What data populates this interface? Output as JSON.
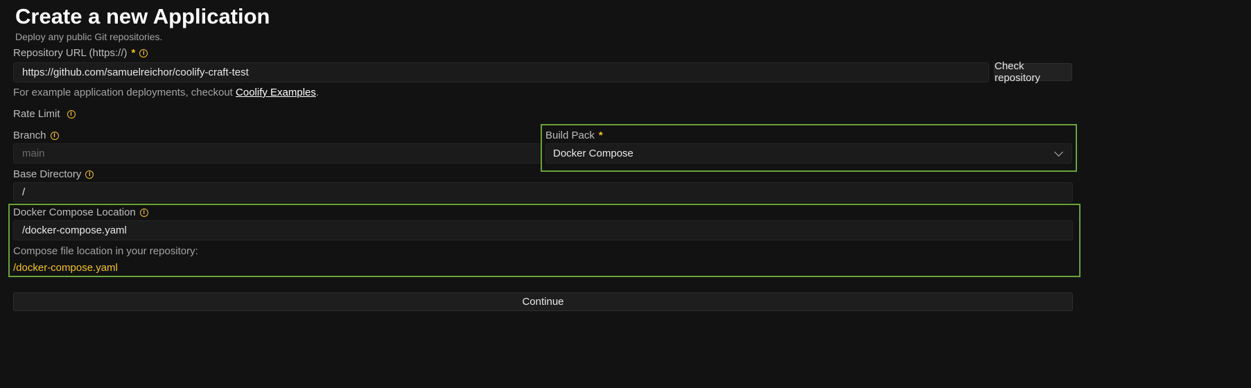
{
  "header": {
    "title": "Create a new Application",
    "subtitle": "Deploy any public Git repositories."
  },
  "repository": {
    "label": "Repository URL (https://)",
    "required_mark": "*",
    "value": "https://github.com/samuelreichor/coolify-craft-test",
    "check_button": "Check repository",
    "example_prefix": "For example application deployments, checkout ",
    "example_link": "Coolify Examples",
    "example_suffix": "."
  },
  "rate_limit": {
    "label": "Rate Limit"
  },
  "branch": {
    "label": "Branch",
    "value": "main"
  },
  "build_pack": {
    "label": "Build Pack",
    "required_mark": "*",
    "selected": "Docker Compose"
  },
  "base_directory": {
    "label": "Base Directory",
    "value": "/"
  },
  "compose": {
    "label": "Docker Compose Location",
    "value": "/docker-compose.yaml",
    "hint": "Compose file location in your repository:",
    "resolved_path": "/docker-compose.yaml"
  },
  "footer": {
    "continue_button": "Continue"
  },
  "colors": {
    "accent": "#f5c518",
    "highlight": "#6aa33a",
    "background": "#121212"
  }
}
